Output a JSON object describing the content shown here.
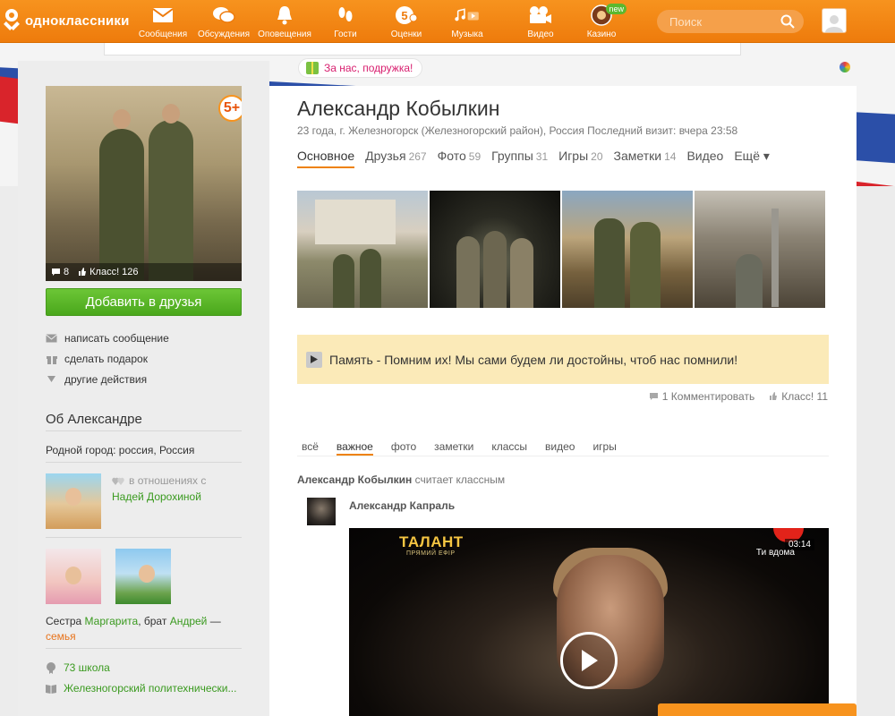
{
  "brand": {
    "name": "одноклассники",
    "accent": "#f7931e",
    "link_green": "#3a9a1f"
  },
  "nav": [
    {
      "label": "Сообщения",
      "icon": "envelope-icon"
    },
    {
      "label": "Обсуждения",
      "icon": "chat-bubbles-icon"
    },
    {
      "label": "Оповещения",
      "icon": "bell-icon"
    },
    {
      "label": "Гости",
      "icon": "footprints-icon"
    },
    {
      "label": "Оценки",
      "icon": "rating-5-icon"
    },
    {
      "label": "Музыка",
      "icon": "music-note-icon"
    },
    {
      "label": "Видео",
      "icon": "video-camera-icon"
    },
    {
      "label": "Казино",
      "icon": "casino-icon",
      "badge": "new"
    }
  ],
  "search": {
    "placeholder": "Поиск"
  },
  "promo": {
    "label": "За нас, подружка!"
  },
  "profile": {
    "name": "Александр Кобылкин",
    "meta": "23 года, г. Железногорск (Железногорский район), Россия  Последний визит: вчера 23:58",
    "rating_badge": "5+",
    "photo_comments": "8",
    "photo_likes": "Класс! 126",
    "add_friend": "Добавить в друзья",
    "actions": [
      {
        "label": "написать сообщение",
        "icon": "envelope-icon"
      },
      {
        "label": "сделать подарок",
        "icon": "gift-icon"
      },
      {
        "label": "другие действия",
        "icon": "triangle-down-icon"
      }
    ]
  },
  "tabs": [
    {
      "label": "Основное",
      "count": ""
    },
    {
      "label": "Друзья",
      "count": "267"
    },
    {
      "label": "Фото",
      "count": "59"
    },
    {
      "label": "Группы",
      "count": "31"
    },
    {
      "label": "Игры",
      "count": "20"
    },
    {
      "label": "Заметки",
      "count": "14"
    },
    {
      "label": "Видео",
      "count": ""
    },
    {
      "label": "Ещё ▾",
      "count": ""
    }
  ],
  "about": {
    "title": "Об Александре",
    "hometown": "Родной город: россия, Россия",
    "relationship_status": "в отношениях с",
    "relationship_partner": "Надей Дорохиной",
    "family_prefix": "Сестра ",
    "sister": "Маргарита",
    "family_mid": ", брат ",
    "brother": "Андрей",
    "family_suffix": " —",
    "family_link": "семья",
    "school": "73 школа",
    "college": "Железногорский политехнически..."
  },
  "memory": {
    "text": "Память - Помним их! Мы сами будем ли достойны, чтоб нас помнили!",
    "comments": "1 Комментировать",
    "likes": "Класс! 11"
  },
  "feed_tabs": [
    "всё",
    "важное",
    "фото",
    "заметки",
    "классы",
    "видео",
    "игры"
  ],
  "feed": {
    "actor": "Александр Кобылкин",
    "action": " считает классным",
    "author": "Александр Капраль",
    "video_title_logo": "ТАЛАНТ",
    "video_subtitle": "ПРЯМИЙ ЕФІР",
    "video_duration": "03:14",
    "video_channel": "Ти вдома"
  }
}
